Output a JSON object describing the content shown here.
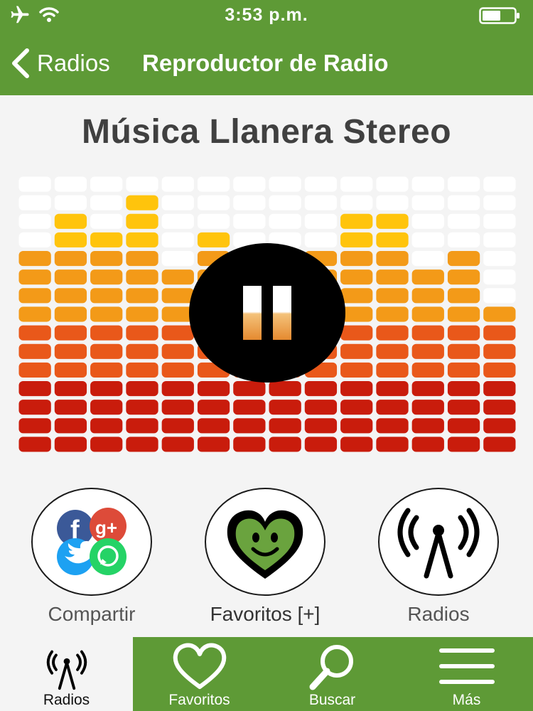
{
  "status_bar": {
    "time": "3:53 p.m.",
    "icons": [
      "airplane-icon",
      "wifi-icon",
      "battery-icon"
    ]
  },
  "nav": {
    "back_label": "Radios",
    "title": "Reproductor de Radio"
  },
  "station": {
    "name": "Música Llanera Stereo"
  },
  "equalizer": {
    "rows": 15,
    "levels": [
      11,
      13,
      12,
      14,
      10,
      12,
      8,
      7,
      11,
      13,
      13,
      10,
      11,
      8
    ],
    "colors": {
      "off": "#ffffff",
      "top": "#ffc40c",
      "mid": "#f39a18",
      "low": "#e9581a",
      "bottom": "#c91c0c"
    }
  },
  "player": {
    "state": "playing",
    "control_icon": "pause-icon"
  },
  "actions": [
    {
      "label": "Compartir",
      "icon": "social-share-icon"
    },
    {
      "label": "Favoritos [+]",
      "icon": "heart-smile-icon"
    },
    {
      "label": "Radios",
      "icon": "radio-tower-icon"
    }
  ],
  "tabs": [
    {
      "label": "Radios",
      "icon": "radio-tower-icon",
      "active": true
    },
    {
      "label": "Favoritos",
      "icon": "heart-icon",
      "active": false
    },
    {
      "label": "Buscar",
      "icon": "search-icon",
      "active": false
    },
    {
      "label": "Más",
      "icon": "menu-icon",
      "active": false
    }
  ],
  "colors": {
    "brand_green": "#5e9a36",
    "title_text": "#404040"
  }
}
